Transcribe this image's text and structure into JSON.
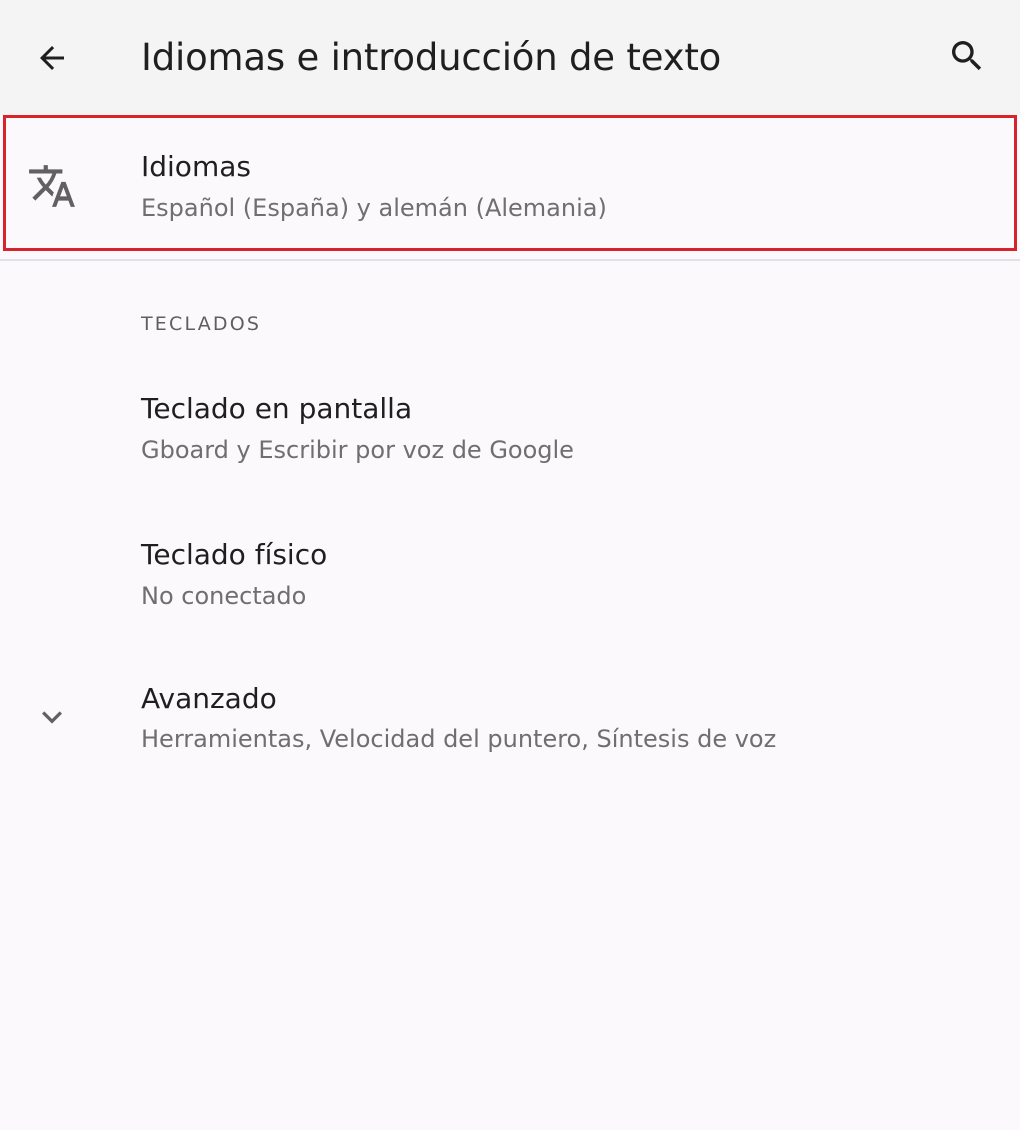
{
  "toolbar": {
    "title": "Idiomas e introducción de texto",
    "back_icon": "arrow-back-icon",
    "search_icon": "search-icon"
  },
  "items": {
    "languages": {
      "icon": "translate-icon",
      "title": "Idiomas",
      "summary": "Español (España) y alemán (Alemania)"
    },
    "keyboards_header": "TECLADOS",
    "onscreen_keyboard": {
      "title": "Teclado en pantalla",
      "summary": "Gboard y Escribir por voz de Google"
    },
    "physical_keyboard": {
      "title": "Teclado físico",
      "summary": "No conectado"
    },
    "advanced": {
      "icon": "chevron-down-icon",
      "title": "Avanzado",
      "summary": "Herramientas, Velocidad del puntero, Síntesis de voz"
    }
  },
  "colors": {
    "background": "#fbf9fc",
    "toolbar": "#f4f4f4",
    "highlight": "#d9232c",
    "text_primary": "#1f1f1f",
    "text_secondary": "#6f6f6f"
  }
}
